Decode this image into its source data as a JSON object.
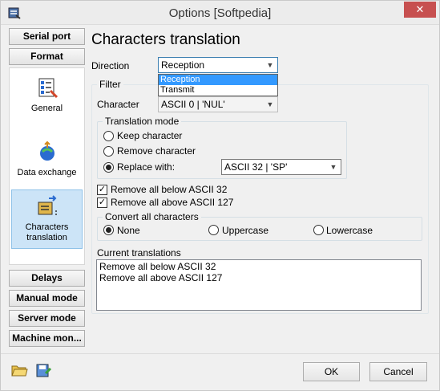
{
  "window": {
    "title": "Options [Softpedia]",
    "close_glyph": "✕"
  },
  "nav": {
    "top_buttons": [
      "Serial port",
      "Format"
    ],
    "items": [
      {
        "label": "General",
        "icon": "general-settings-icon"
      },
      {
        "label": "Data exchange",
        "icon": "data-exchange-icon"
      },
      {
        "label": "Characters translation",
        "icon": "characters-translation-icon",
        "selected": true
      }
    ],
    "bottom_buttons": [
      "Delays",
      "Manual mode",
      "Server mode",
      "Machine mon..."
    ]
  },
  "content": {
    "heading": "Characters translation",
    "direction": {
      "label": "Direction",
      "value": "Reception",
      "options": [
        "Reception",
        "Transmit"
      ]
    },
    "filter": {
      "title": "Filter",
      "character_label": "Character",
      "character_value": "ASCII 0 | 'NUL'"
    },
    "translation_mode": {
      "title": "Translation mode",
      "options": [
        "Keep character",
        "Remove character",
        "Replace with:"
      ],
      "selected": 2,
      "replace_value": "ASCII 32 | 'SP'"
    },
    "checks": [
      {
        "label": "Remove all below ASCII 32",
        "checked": true
      },
      {
        "label": "Remove all above ASCII 127",
        "checked": true
      }
    ],
    "convert": {
      "title": "Convert all characters",
      "options": [
        "None",
        "Uppercase",
        "Lowercase"
      ],
      "selected": 0
    },
    "current": {
      "title": "Current translations",
      "lines": [
        "Remove all below ASCII 32",
        "Remove all above ASCII 127"
      ]
    }
  },
  "footer": {
    "ok": "OK",
    "cancel": "Cancel"
  }
}
